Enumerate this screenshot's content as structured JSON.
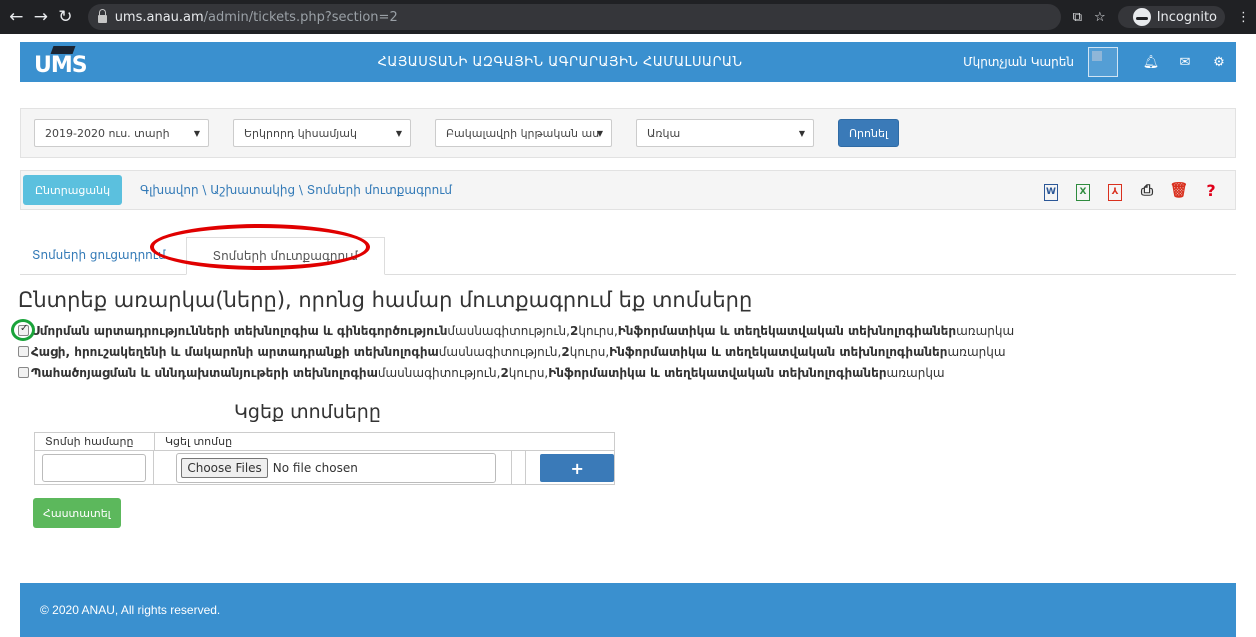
{
  "browser": {
    "url_host": "ums.anau.am",
    "url_path": "/admin/tickets.php?section=2",
    "incognito_label": "Incognito"
  },
  "header": {
    "logo_text": "UMS",
    "title": "ՀԱՅԱՍՏԱՆԻ ԱԶԳԱՅԻՆ ԱԳՐԱՐԱՅԻՆ ՀԱՄԱԼՍԱՐԱՆ",
    "user_name": "Մկրտչյան Կարեն",
    "icons": [
      "bell-icon",
      "envelope-icon",
      "gear-icon"
    ]
  },
  "filters": {
    "year": "2019-2020 ուս. տարի",
    "semester": "Երկրորդ կիսամյակ",
    "level": "Բակալավրի կրթական աս",
    "form": "Առկա",
    "submit_label": "Որոնել"
  },
  "crumbs": {
    "list_button": "Ընտրացանկ",
    "path": "Գլխավոր \\ Աշխատակից \\ Տոմսերի մուտքագրում"
  },
  "tabs": {
    "list": "Տոմսերի ցուցադրում",
    "entry": "Տոմսերի մուտքագրում"
  },
  "main": {
    "heading": "Ընտրեք առարկա(ները), որոնց համար մուտքագրում եք տոմսերը"
  },
  "subjects": [
    {
      "checked": true,
      "name": "Սմորման արտադրությունների տեխնոլոգիա և գինեգործություն",
      "specialty_label": " մասնագիտություն, ",
      "course_num": "2",
      "course_label": " կուրս, ",
      "subject": "Ինֆորմատիկա և տեղեկատվական տեխնոլոգիաներ",
      "subject_label": " առարկա"
    },
    {
      "checked": false,
      "name": "Հացի, հրուշակեղենի և մակարոնի արտադրանքի տեխնոլոգիա",
      "specialty_label": " մասնագիտություն, ",
      "course_num": "2",
      "course_label": " կուրս, ",
      "subject": "Ինֆորմատիկա և տեղեկատվական տեխնոլոգիաներ",
      "subject_label": " առարկա"
    },
    {
      "checked": false,
      "name": "Պահածոյացման և սննդախտանյութերի տեխնոլոգիա",
      "specialty_label": " մասնագիտություն, ",
      "course_num": "2",
      "course_label": " կուրս, ",
      "subject": "Ինֆորմատիկա և տեղեկատվական տեխնոլոգիաներ",
      "subject_label": " առարկա"
    }
  ],
  "upload": {
    "title": "Կցեք տոմսերը",
    "col_number": "Տոմսի համարը",
    "col_file": "Կցել տոմսը",
    "choose_files": "Choose Files",
    "no_file": "No file chosen",
    "add": "+",
    "confirm": "Հաստատել"
  },
  "footer": {
    "copyright": "© 2020 ANAU, All rights reserved."
  }
}
